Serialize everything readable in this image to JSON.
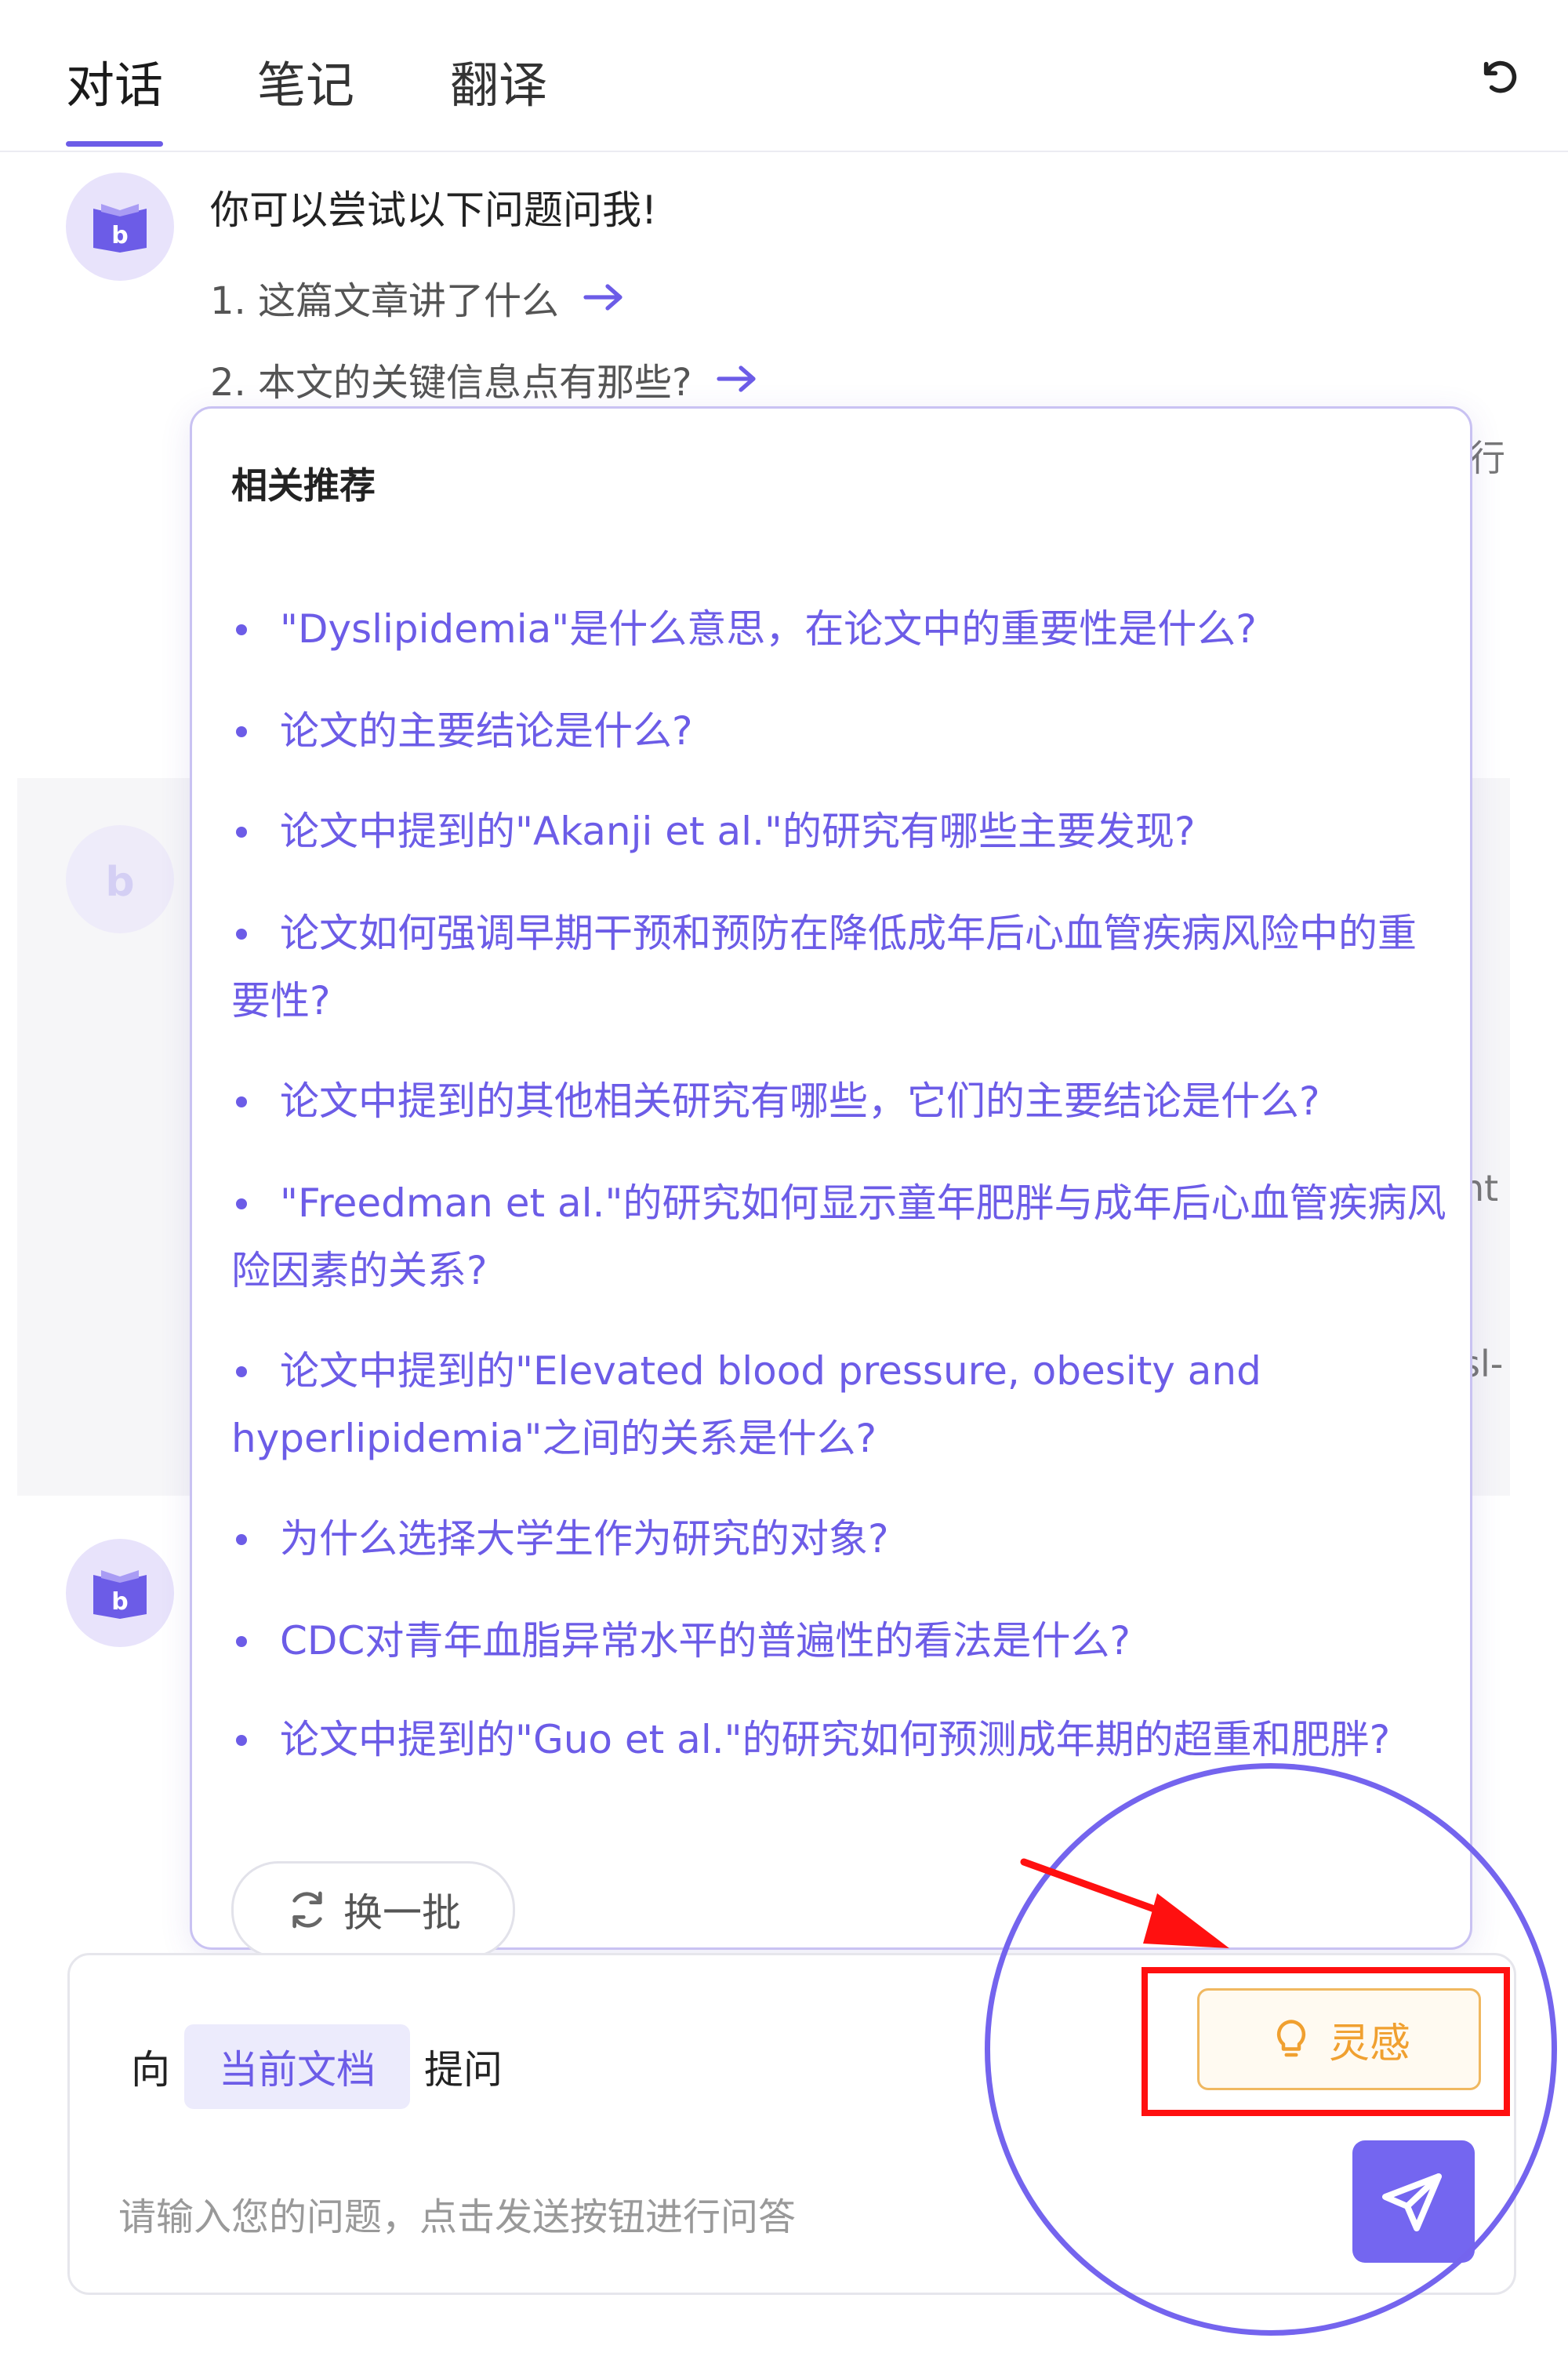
{
  "tabs": [
    {
      "label": "对话",
      "active": true
    },
    {
      "label": "笔记",
      "active": false
    },
    {
      "label": "翻译",
      "active": false
    }
  ],
  "chat": {
    "intro": "你可以尝试以下问题问我!",
    "suggestions": [
      "1. 这篇文章讲了什么",
      "2. 本文的关键信息点有那些?"
    ],
    "peek_fragments": [
      "行",
      "nt",
      "sl-"
    ]
  },
  "popup": {
    "title": "相关推荐",
    "items": [
      "\"Dyslipidemia\"是什么意思，在论文中的重要性是什么?",
      "论文的主要结论是什么?",
      "论文中提到的\"Akanji et al.\"的研究有哪些主要发现?",
      "论文如何强调早期干预和预防在降低成年后心血管疾病风险中的重要性?",
      "论文中提到的其他相关研究有哪些，它们的主要结论是什么?",
      "\"Freedman et al.\"的研究如何显示童年肥胖与成年后心血管疾病风险因素的关系?",
      "论文中提到的\"Elevated blood pressure, obesity and hyperlipidemia\"之间的关系是什么?",
      "为什么选择大学生作为研究的对象?",
      "CDC对青年血脂异常水平的普遍性的看法是什么?",
      "论文中提到的\"Guo et al.\"的研究如何预测成年期的超重和肥胖?"
    ],
    "refresh_label": "换一批"
  },
  "input": {
    "ask_prefix": "向",
    "doc_chip": "当前文档",
    "ask_suffix": "提问",
    "inspire_label": "灵感",
    "placeholder": "请输入您的问题，点击发送按钮进行问答"
  },
  "colors": {
    "accent": "#6c5ce7",
    "inspire": "#f0a030",
    "annotation_red": "#ff1010",
    "annotation_circle": "#7464ee"
  },
  "icons": {
    "reset": "refresh-ccw-icon",
    "avatar": "book-icon",
    "arrow": "arrow-right-icon",
    "refresh": "refresh-icon",
    "inspire": "lightbulb-icon",
    "send": "send-icon"
  }
}
